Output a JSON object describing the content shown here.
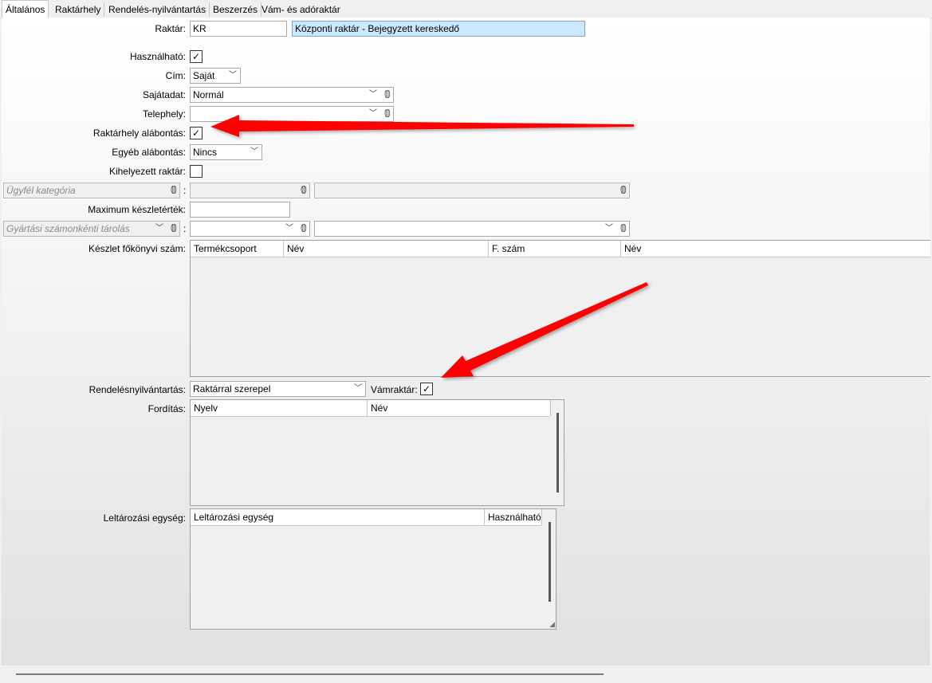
{
  "tabs": [
    {
      "label": "Általános"
    },
    {
      "label": "Raktárhely"
    },
    {
      "label": "Rendelés-nyilvántartás"
    },
    {
      "label": "Beszerzés"
    },
    {
      "label": "Vám- és adóraktár"
    }
  ],
  "form": {
    "raktar_label": "Raktár:",
    "raktar_code": "KR",
    "raktar_name": "Központi raktár - Bejegyzett kereskedő",
    "hasznalhato_label": "Használható:",
    "cim_label": "Cím:",
    "cim_value": "Saját",
    "sajatadat_label": "Sajátadat:",
    "sajatadat_value": "Normál",
    "telephely_label": "Telephely:",
    "telephely_value": "",
    "raktarhely_label": "Raktárhely alábontás:",
    "egyeb_label": "Egyéb alábontás:",
    "egyeb_value": "Nincs",
    "kihelyezett_label": "Kihelyezett raktár:",
    "ugyfel_placeholder": "Ügyfél kategória",
    "max_label": "Maximum készletérték:",
    "gyartasi_placeholder": "Gyártási számonkénti tárolás",
    "keszlet_label": "Készlet főkönyvi szám:",
    "rendeles_label": "Rendelésnyilvántartás:",
    "rendeles_value": "Raktárral szerepel",
    "vamraktar_label": "Vámraktár:",
    "forditas_label": "Fordítás:",
    "leltar_label": "Leltározási egység:",
    "colon": ":",
    "check_mark": "✓"
  },
  "checks": {
    "hasznalhato": true,
    "raktarhely": true,
    "kihelyezett": false,
    "vamraktar": true
  },
  "keszlet_grid": {
    "columns": [
      "Termékcsoport",
      "Név",
      "F. szám",
      "Név"
    ]
  },
  "forditas_grid": {
    "columns": [
      "Nyelv",
      "Név"
    ]
  },
  "leltar_grid": {
    "columns": [
      "Leltározási egység",
      "Használható"
    ]
  },
  "icons": {
    "chevron": "chevron-down-icon",
    "clip": "paperclip-icon"
  },
  "colors": {
    "selection": "#cce8ff",
    "arrow": "#ff0000"
  }
}
